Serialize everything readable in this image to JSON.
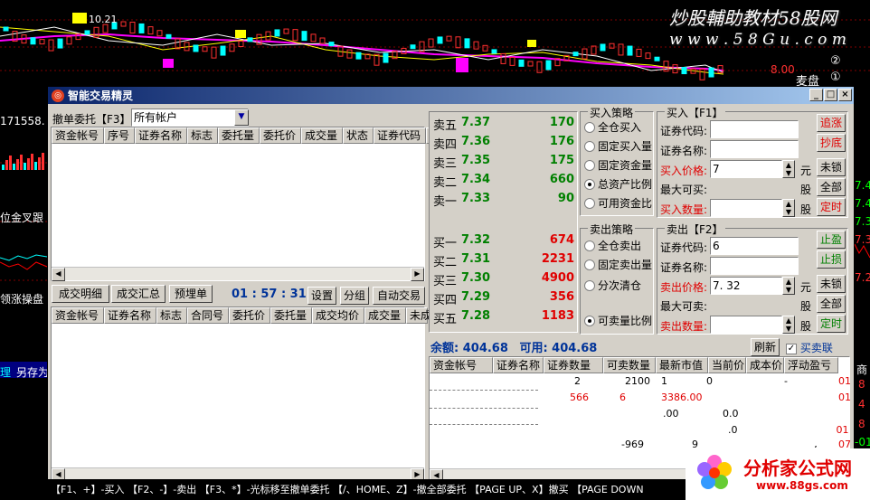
{
  "background": {
    "watermark_cn": "炒股輔助教材58股网",
    "watermark_url": "w w w . 5 8 G u . c o m",
    "price_marker": "10.21",
    "right_price": "8.00",
    "right_label": "麦盘",
    "circle_labels": [
      "②",
      "①"
    ],
    "left_labels": [
      "171558.",
      "位金叉跟",
      "领涨操盘",
      "理",
      "另存为"
    ],
    "right_values": [
      "7.4",
      "7.4",
      "7.3",
      "7.3",
      "7.2"
    ],
    "right_values2": [
      "8",
      "4",
      "8",
      "-01",
      "62"
    ],
    "right_misc": "商"
  },
  "window": {
    "title": "智能交易精灵",
    "min": "_",
    "max": "□",
    "close": "×"
  },
  "orders": {
    "label": "撤单委托【F3】",
    "account_select": "所有帐户",
    "columns": [
      "资金帐号",
      "序号",
      "证券名称",
      "标志",
      "委托量",
      "委托价",
      "成交量",
      "状态",
      "证券代码",
      "委"
    ]
  },
  "trades": {
    "tab_detail": "成交明细",
    "tab_summary": "成交汇总",
    "tab_preorder": "预埋单",
    "clock": "01 : 57 : 31",
    "btn_settings": "设置",
    "btn_group": "分组",
    "btn_auto": "自动交易",
    "columns": [
      "资金帐号",
      "证券名称",
      "标志",
      "合同号",
      "委托价",
      "委托量",
      "成交均价",
      "成交量",
      "未成"
    ]
  },
  "quote": {
    "asks": [
      {
        "name": "卖五",
        "price": "7.37",
        "vol": "170"
      },
      {
        "name": "卖四",
        "price": "7.36",
        "vol": "176"
      },
      {
        "name": "卖三",
        "price": "7.35",
        "vol": "175"
      },
      {
        "name": "卖二",
        "price": "7.34",
        "vol": "660"
      },
      {
        "name": "卖一",
        "price": "7.33",
        "vol": "90"
      }
    ],
    "bids": [
      {
        "name": "买一",
        "price": "7.32",
        "vol": "674"
      },
      {
        "name": "买二",
        "price": "7.31",
        "vol": "2231"
      },
      {
        "name": "买三",
        "price": "7.30",
        "vol": "4900"
      },
      {
        "name": "买四",
        "price": "7.29",
        "vol": "356"
      },
      {
        "name": "买五",
        "price": "7.28",
        "vol": "1183"
      }
    ]
  },
  "buy_strategy": {
    "title": "买入策略",
    "options": [
      "全仓买入",
      "固定买入量",
      "固定资金量",
      "总资产比例",
      "可用资金比"
    ],
    "selected": 3
  },
  "sell_strategy": {
    "title": "卖出策略",
    "options": [
      "全仓卖出",
      "固定卖出量",
      "分次清仓",
      "可卖量比例"
    ],
    "selected": 3
  },
  "buy": {
    "title": "买入【F1】",
    "code_label": "证券代码:",
    "name_label": "证券名称:",
    "name_value": "",
    "price_label": "买入价格:",
    "price_value": "7",
    "yuan": "元",
    "max_label": "最大可买:",
    "qty_label": "买入数量:",
    "unit": "股",
    "btn_chase": "追涨",
    "btn_bottom": "抄底",
    "btn_unlock": "未锁",
    "btn_all": "全部",
    "btn_timed": "定时"
  },
  "sell": {
    "title": "卖出【F2】",
    "code_label": "证券代码:",
    "code_value": "6",
    "name_label": "证券名称:",
    "name_value": "",
    "price_label": "卖出价格:",
    "price_value": "7. 32",
    "yuan": "元",
    "max_label": "最大可卖:",
    "qty_label": "卖出数量:",
    "unit": "股",
    "btn_take_profit": "止盈",
    "btn_stop_loss": "止损",
    "btn_unlock": "未锁",
    "btn_all": "全部",
    "btn_timed": "定时"
  },
  "balance": {
    "label": "余额:",
    "value": "404.68",
    "avail_label": "可用:",
    "avail_value": "404.68",
    "btn_refresh": "刷新",
    "chk_linkage": "买卖联",
    "check_mark": "✓"
  },
  "positions": {
    "columns": [
      "资金帐号",
      "证券名称",
      "证券数量",
      "可卖数量",
      "最新市值",
      "当前价",
      "成本价",
      "浮动盈亏"
    ],
    "row1": [
      "2",
      "2100",
      "1",
      "0"
    ],
    "row1_extra": "01",
    "row1_extra2": "-",
    "row2_code": "",
    "row2": [
      "566",
      "6",
      "3386.00"
    ],
    "row2_extra": "01",
    "row3": [
      ".00",
      "0.0"
    ],
    "row4": [
      ".0"
    ],
    "row4_extra": ".01",
    "row5": [
      "-969",
      "9"
    ],
    "row5_extra": "-7",
    "row5_extra2": "07"
  },
  "statusbar": "【F1、+】-买入 【F2、-】-卖出 【F3、*】-光标移至撤单委托 【/、HOME、Z】-撤全部委托 【PAGE UP、X】撤买 【PAGE DOWN",
  "logo": {
    "name": "分析家公式网",
    "url": "www.88gs.com"
  },
  "colors": {
    "title_start": "#0a246a",
    "title_end": "#a6caf0",
    "ask_green": "#008000",
    "bid_red": "#e00000",
    "balance_blue": "#003399"
  }
}
